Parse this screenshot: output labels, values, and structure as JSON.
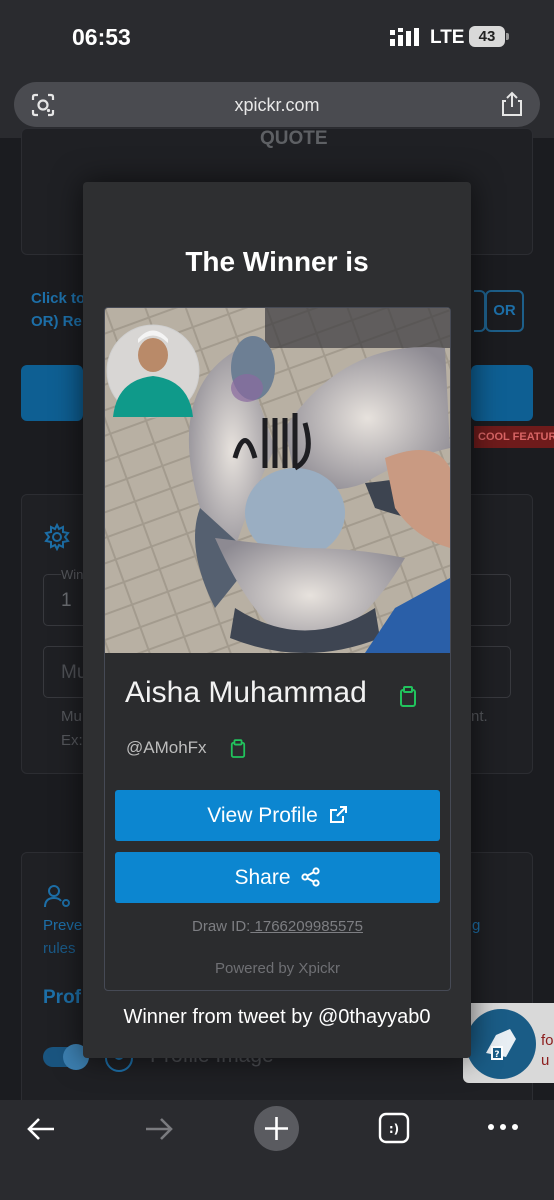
{
  "status_bar": {
    "time": "06:53",
    "network": "LTE",
    "battery": "43"
  },
  "browser": {
    "url": "xpickr.com"
  },
  "background_page": {
    "quote_label": "QUOTE",
    "click_text_line1": "Click to",
    "click_text_line2": "OR) Re",
    "or_button": "OR",
    "cool_feature": "COOL FEATURE",
    "winners_label": "Win",
    "winners_value": "1",
    "input_hint": "Mu",
    "help_line1": "Mu",
    "help_line1_end": "nt.",
    "help_line2": "Ex:",
    "prevent_text": "Preve",
    "prevent_end": "g",
    "rules_text": "rules",
    "profile_heading": "Prof",
    "profile_image_label": "Profile Image",
    "badge_text": "fo\nu do"
  },
  "modal": {
    "title": "The Winner is",
    "winner_name": "Aisha Muhammad",
    "winner_handle": "@AMohFx",
    "view_profile": "View Profile",
    "share": "Share",
    "draw_id_label": "Draw ID:",
    "draw_id_value": " 1766209985575",
    "powered_by": "Powered by Xpickr",
    "footnote": "Winner from tweet by @0thayyab0"
  },
  "colors": {
    "button_blue": "#0c86d0",
    "copy_green": "#21c45d",
    "modal_bg": "#2e2f31"
  }
}
